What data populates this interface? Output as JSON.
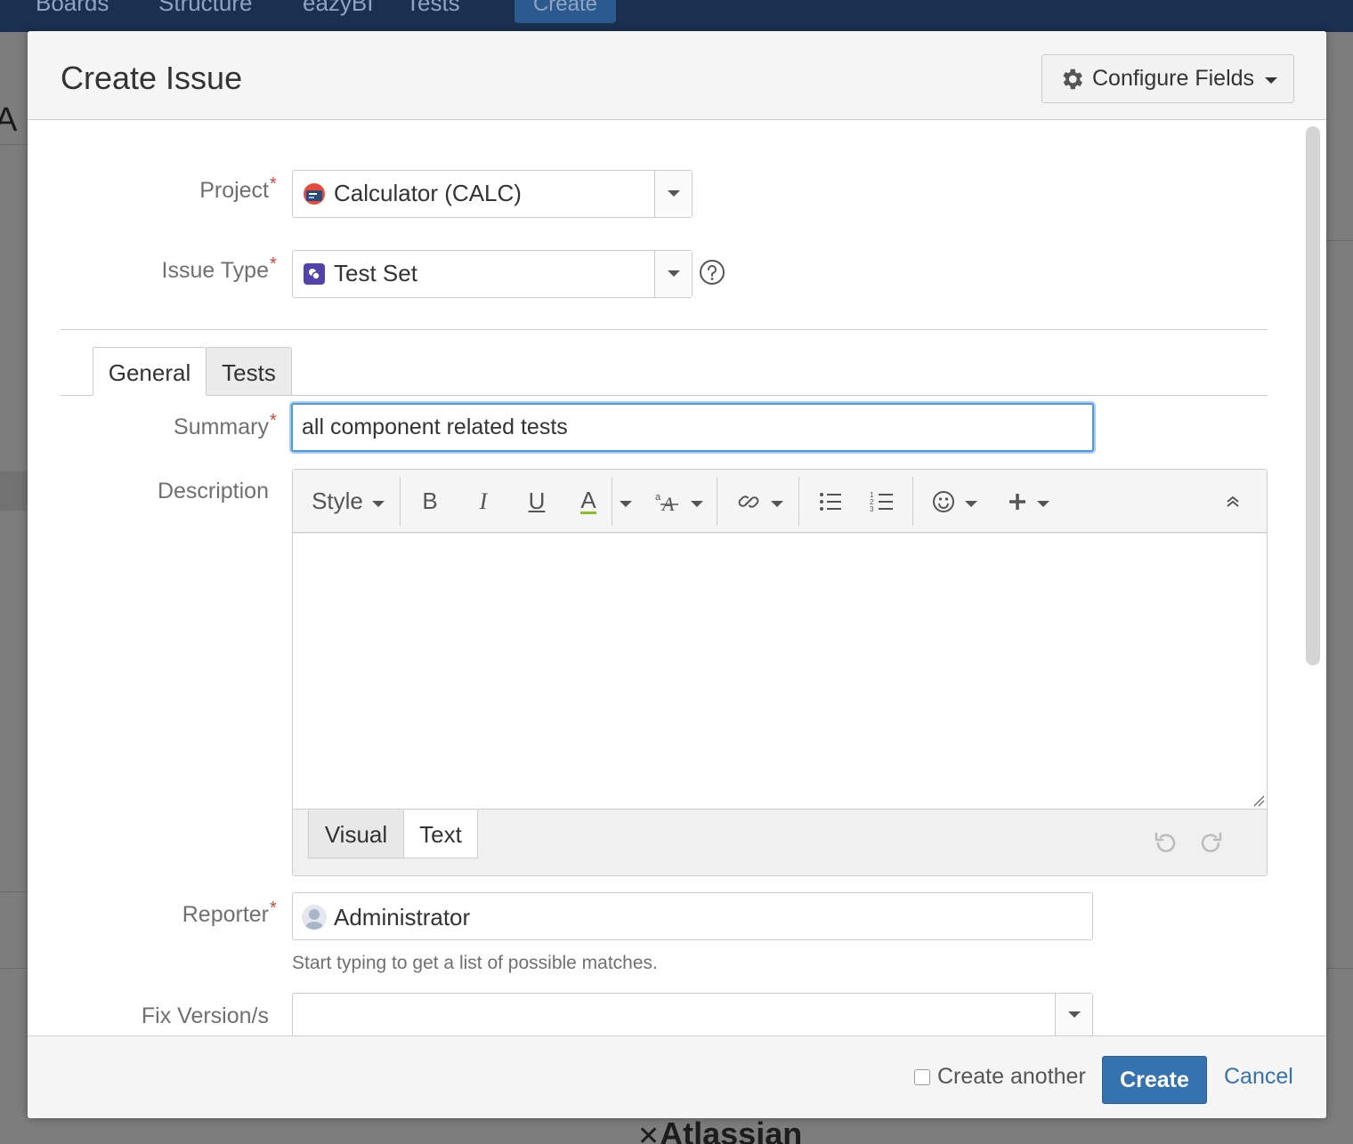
{
  "background": {
    "nav_items": [
      "Boards",
      "Structure",
      "eazyBI",
      "Tests"
    ],
    "nav_create": "Create",
    "page_fragment": "A",
    "footer_logo": "Atlassian"
  },
  "dialog": {
    "title": "Create Issue",
    "configure_fields_label": "Configure Fields"
  },
  "fields": {
    "project": {
      "label": "Project",
      "value": "Calculator (CALC)",
      "required_mark": "*"
    },
    "issue_type": {
      "label": "Issue Type",
      "value": "Test Set",
      "required_mark": "*"
    },
    "summary": {
      "label": "Summary",
      "value": "all component related tests",
      "required_mark": "*"
    },
    "description": {
      "label": "Description"
    },
    "reporter": {
      "label": "Reporter",
      "value": "Administrator",
      "required_mark": "*",
      "hint": "Start typing to get a list of possible matches."
    },
    "fix_version": {
      "label": "Fix Version/s",
      "value": ""
    }
  },
  "tabs": [
    {
      "label": "General",
      "active": true
    },
    {
      "label": "Tests",
      "active": false
    }
  ],
  "editor": {
    "toolbar": {
      "style_label": "Style",
      "bold_label": "B",
      "italic_label": "I",
      "underline_label": "U",
      "color_label": "A"
    },
    "mode_tabs": {
      "visual": "Visual",
      "text": "Text"
    },
    "content": ""
  },
  "footer": {
    "create_another_label": "Create another",
    "create_label": "Create",
    "cancel_label": "Cancel"
  },
  "colors": {
    "primary": "#3572b0",
    "required": "#d04437",
    "focus": "#4a9ae1",
    "test_set_icon": "#5243aa",
    "nav_bg": "#1b3050"
  },
  "icons": [
    "gear-icon",
    "project-avatar-icon",
    "test-set-icon",
    "help-icon",
    "link-icon",
    "bullet-list-icon",
    "numbered-list-icon",
    "emoticon-icon",
    "plus-icon",
    "collapse-icon",
    "undo-icon",
    "redo-icon",
    "user-avatar-icon"
  ]
}
